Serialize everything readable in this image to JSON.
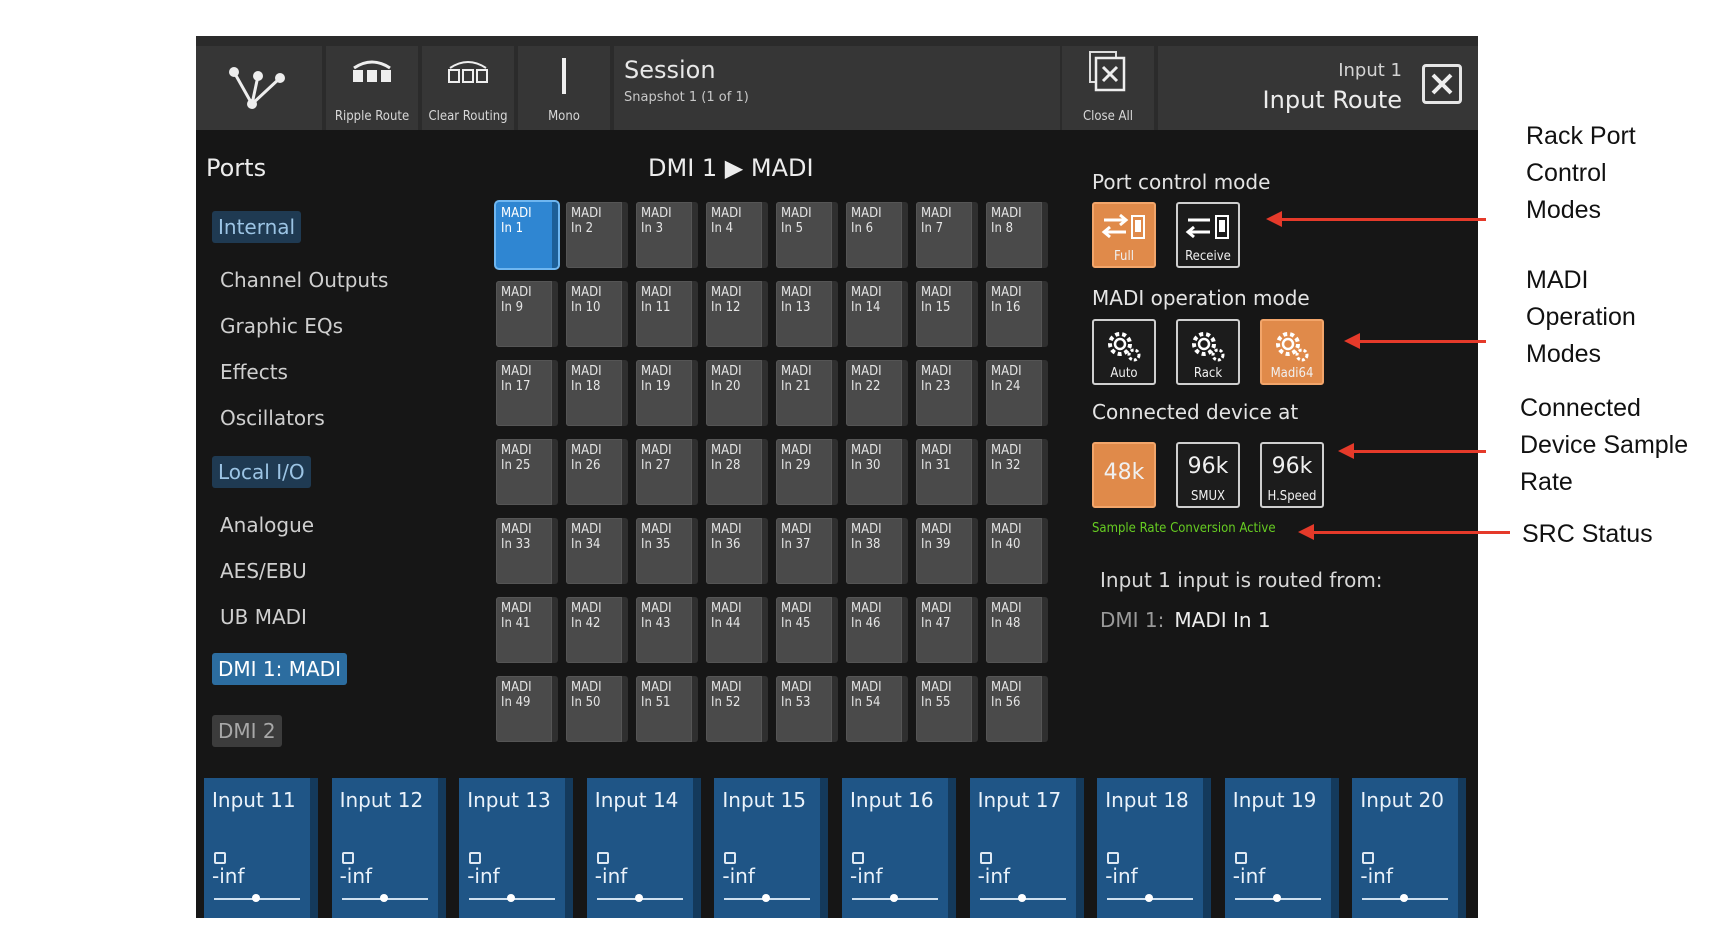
{
  "toolbar": {
    "ripple_label": "Ripple Route",
    "clear_label": "Clear Routing",
    "mono_label": "Mono",
    "session_title": "Session",
    "session_snapshot": "Snapshot 1 (1 of 1)",
    "close_all_label": "Close All",
    "route_channel": "Input 1",
    "route_title": "Input Route"
  },
  "sidebar": {
    "title": "Ports",
    "cat_internal": "Internal",
    "channel_outputs": "Channel Outputs",
    "graphic_eqs": "Graphic EQs",
    "effects": "Effects",
    "oscillators": "Oscillators",
    "cat_local": "Local I/O",
    "analogue": "Analogue",
    "aes_ebu": "AES/EBU",
    "ub_madi": "UB MADI",
    "dmi1": "DMI 1: MADI",
    "dmi2": "DMI 2"
  },
  "grid": {
    "title": "DMI 1 ▶ MADI",
    "prefix": "MADI",
    "cells": [
      "In 1",
      "In 2",
      "In 3",
      "In 4",
      "In 5",
      "In 6",
      "In 7",
      "In 8",
      "In 9",
      "In 10",
      "In 11",
      "In 12",
      "In 13",
      "In 14",
      "In 15",
      "In 16",
      "In 17",
      "In 18",
      "In 19",
      "In 20",
      "In 21",
      "In 22",
      "In 23",
      "In 24",
      "In 25",
      "In 26",
      "In 27",
      "In 28",
      "In 29",
      "In 30",
      "In 31",
      "In 32",
      "In 33",
      "In 34",
      "In 35",
      "In 36",
      "In 37",
      "In 38",
      "In 39",
      "In 40",
      "In 41",
      "In 42",
      "In 43",
      "In 44",
      "In 45",
      "In 46",
      "In 47",
      "In 48",
      "In 49",
      "In 50",
      "In 51",
      "In 52",
      "In 53",
      "In 54",
      "In 55",
      "In 56"
    ]
  },
  "panel": {
    "port_mode_label": "Port control mode",
    "full": "Full",
    "receive": "Receive",
    "madi_mode_label": "MADI operation mode",
    "auto": "Auto",
    "rack": "Rack",
    "madi64": "Madi64",
    "connected_label": "Connected device at",
    "rate_48k": "48k",
    "rate_96k": "96k",
    "smux": "SMUX",
    "hspeed": "H.Speed",
    "src_status": "Sample Rate Conversion Active",
    "routed_line": "Input 1 input is routed from:",
    "routed_key": "DMI 1:",
    "routed_value": "MADI In 1",
    "accent": "#e08a4a",
    "src_color": "#66cc22"
  },
  "strips": [
    {
      "name": "Input 11",
      "level": "-inf"
    },
    {
      "name": "Input 12",
      "level": "-inf"
    },
    {
      "name": "Input 13",
      "level": "-inf"
    },
    {
      "name": "Input 14",
      "level": "-inf"
    },
    {
      "name": "Input 15",
      "level": "-inf"
    },
    {
      "name": "Input 16",
      "level": "-inf"
    },
    {
      "name": "Input 17",
      "level": "-inf"
    },
    {
      "name": "Input 18",
      "level": "-inf"
    },
    {
      "name": "Input 19",
      "level": "-inf"
    },
    {
      "name": "Input 20",
      "level": "-inf"
    }
  ],
  "annotations": {
    "rack_port": [
      "Rack Port",
      "Control",
      "Modes"
    ],
    "madi_op": [
      "MADI",
      "Operation",
      "Modes"
    ],
    "connected": [
      "Connected",
      "Device Sample",
      "Rate"
    ],
    "src": [
      "SRC Status"
    ],
    "arrow_color": "#e53a2a"
  }
}
